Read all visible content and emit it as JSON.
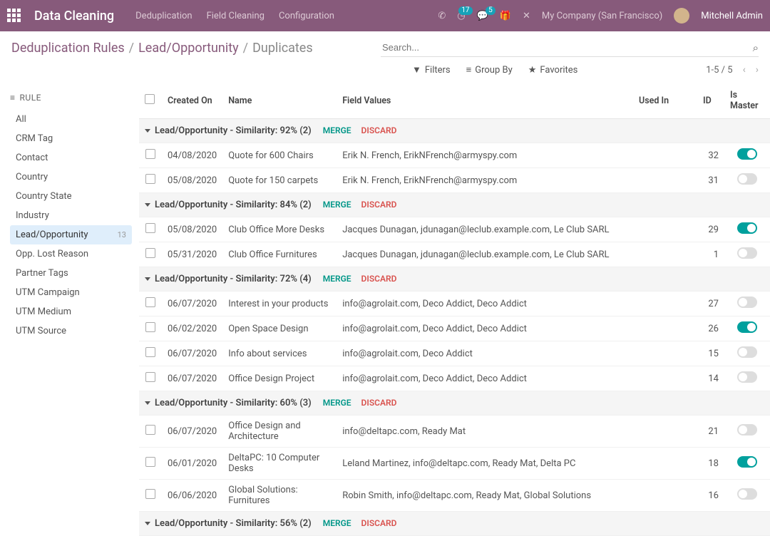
{
  "topbar": {
    "app_title": "Data Cleaning",
    "menu": [
      "Deduplication",
      "Field Cleaning",
      "Configuration"
    ],
    "notif1_count": "17",
    "notif2_count": "5",
    "company": "My Company (San Francisco)",
    "user": "Mitchell Admin"
  },
  "breadcrumb": {
    "a": "Deduplication Rules",
    "b": "Lead/Opportunity",
    "c": "Duplicates"
  },
  "search": {
    "placeholder": "Search..."
  },
  "filters": {
    "filters": "Filters",
    "groupby": "Group By",
    "favorites": "Favorites"
  },
  "pager": {
    "range": "1-5 / 5"
  },
  "sidebar": {
    "title": "RULE",
    "items": [
      {
        "label": "All"
      },
      {
        "label": "CRM Tag"
      },
      {
        "label": "Contact"
      },
      {
        "label": "Country"
      },
      {
        "label": "Country State"
      },
      {
        "label": "Industry"
      },
      {
        "label": "Lead/Opportunity",
        "active": true,
        "count": "13"
      },
      {
        "label": "Opp. Lost Reason"
      },
      {
        "label": "Partner Tags"
      },
      {
        "label": "UTM Campaign"
      },
      {
        "label": "UTM Medium"
      },
      {
        "label": "UTM Source"
      }
    ]
  },
  "columns": {
    "created": "Created On",
    "name": "Name",
    "fieldvalues": "Field Values",
    "usedin": "Used In",
    "id": "ID",
    "master": "Is Master"
  },
  "actions": {
    "merge": "MERGE",
    "discard": "DISCARD"
  },
  "groups": [
    {
      "title": "Lead/Opportunity - Similarity: 92% (2)",
      "rows": [
        {
          "date": "04/08/2020",
          "name": "Quote for 600 Chairs",
          "fv": "Erik N. French, ErikNFrench@armyspy.com",
          "id": "32",
          "master": true
        },
        {
          "date": "05/08/2020",
          "name": "Quote for 150 carpets",
          "fv": "Erik N. French, ErikNFrench@armyspy.com",
          "id": "31",
          "master": false
        }
      ]
    },
    {
      "title": "Lead/Opportunity - Similarity: 84% (2)",
      "rows": [
        {
          "date": "05/08/2020",
          "name": "Club Office More Desks",
          "fv": "Jacques Dunagan, jdunagan@leclub.example.com, Le Club SARL",
          "id": "29",
          "master": true
        },
        {
          "date": "05/31/2020",
          "name": "Club Office Furnitures",
          "fv": "Jacques Dunagan, jdunagan@leclub.example.com, Le Club SARL",
          "id": "1",
          "master": false
        }
      ]
    },
    {
      "title": "Lead/Opportunity - Similarity: 72% (4)",
      "rows": [
        {
          "date": "06/07/2020",
          "name": "Interest in your products",
          "fv": "info@agrolait.com, Deco Addict, Deco Addict",
          "id": "27",
          "master": false
        },
        {
          "date": "06/02/2020",
          "name": "Open Space Design",
          "fv": "info@agrolait.com, Deco Addict, Deco Addict",
          "id": "26",
          "master": true
        },
        {
          "date": "06/07/2020",
          "name": "Info about services",
          "fv": "info@agrolait.com, Deco Addict",
          "id": "15",
          "master": false
        },
        {
          "date": "06/07/2020",
          "name": "Office Design Project",
          "fv": "info@agrolait.com, Deco Addict, Deco Addict",
          "id": "14",
          "master": false
        }
      ]
    },
    {
      "title": "Lead/Opportunity - Similarity: 60% (3)",
      "rows": [
        {
          "date": "06/07/2020",
          "name": "Office Design and Architecture",
          "fv": "info@deltapc.com, Ready Mat",
          "id": "21",
          "master": false
        },
        {
          "date": "06/01/2020",
          "name": "DeltaPC: 10 Computer Desks",
          "fv": "Leland Martinez, info@deltapc.com, Ready Mat, Delta PC",
          "id": "18",
          "master": true
        },
        {
          "date": "06/06/2020",
          "name": "Global Solutions: Furnitures",
          "fv": "Robin Smith, info@deltapc.com, Ready Mat, Global Solutions",
          "id": "16",
          "master": false
        }
      ]
    },
    {
      "title": "Lead/Opportunity - Similarity: 56% (2)",
      "rows": []
    }
  ]
}
